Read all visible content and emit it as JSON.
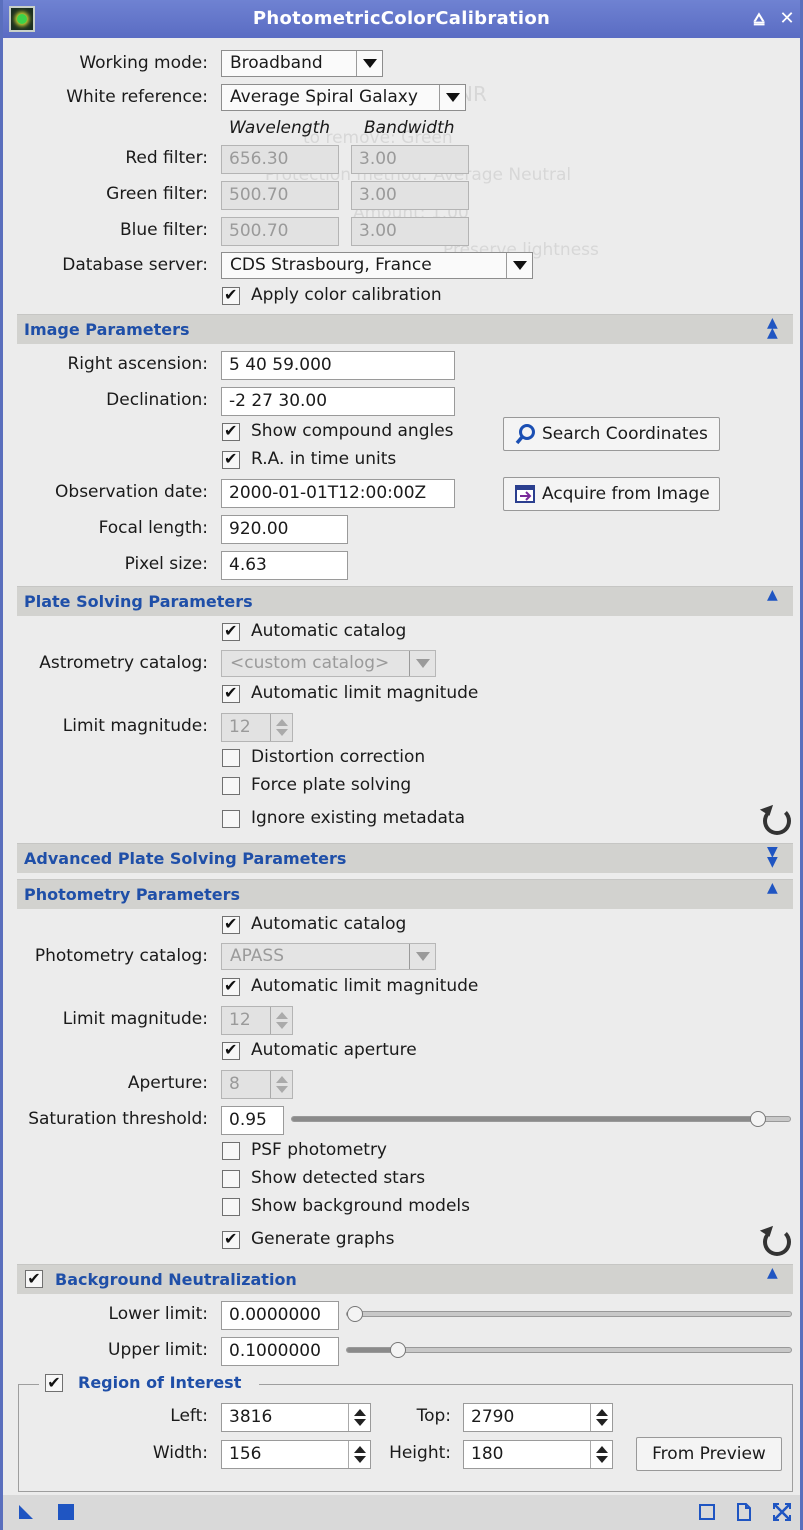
{
  "window": {
    "title": "PhotometricColorCalibration",
    "controls": [
      "pin-icon",
      "close-icon"
    ]
  },
  "general": {
    "working_mode_label": "Working mode:",
    "working_mode_value": "Broadband",
    "white_ref_label": "White reference:",
    "white_ref_value": "Average Spiral Galaxy",
    "col_wavelength": "Wavelength",
    "col_bandwidth": "Bandwidth",
    "red_label": "Red filter:",
    "red_wavelength": "656.30",
    "red_bandwidth": "3.00",
    "green_label": "Green filter:",
    "green_wavelength": "500.70",
    "green_bandwidth": "3.00",
    "blue_label": "Blue filter:",
    "blue_wavelength": "500.70",
    "blue_bandwidth": "3.00",
    "db_label": "Database server:",
    "db_value": "CDS Strasbourg, France",
    "apply_label": "Apply color calibration",
    "apply_checked": true
  },
  "image_params": {
    "title": "Image Parameters",
    "ra_label": "Right ascension:",
    "ra_value": "5 40 59.000",
    "dec_label": "Declination:",
    "dec_value": "-2 27 30.00",
    "compound_label": "Show compound angles",
    "ra_time_label": "R.A. in time units",
    "search_button": "Search Coordinates",
    "obs_label": "Observation date:",
    "obs_value": "2000-01-01T12:00:00Z",
    "acquire_button": "Acquire from Image",
    "focal_label": "Focal length:",
    "focal_value": "920.00",
    "pixel_label": "Pixel size:",
    "pixel_value": "4.63"
  },
  "plate_solving": {
    "title": "Plate Solving Parameters",
    "auto_catalog_label": "Automatic catalog",
    "astrometry_label": "Astrometry catalog:",
    "astrometry_value": "<custom catalog>",
    "auto_limit_label": "Automatic limit magnitude",
    "limit_label": "Limit magnitude:",
    "limit_value": "12",
    "distortion_label": "Distortion correction",
    "force_label": "Force plate solving",
    "ignore_label": "Ignore existing metadata"
  },
  "advanced_plate": {
    "title": "Advanced Plate Solving Parameters"
  },
  "photometry": {
    "title": "Photometry Parameters",
    "auto_catalog_label": "Automatic catalog",
    "catalog_label": "Photometry catalog:",
    "catalog_value": "APASS",
    "auto_limit_label": "Automatic limit magnitude",
    "limit_label": "Limit magnitude:",
    "limit_value": "12",
    "auto_aperture_label": "Automatic aperture",
    "aperture_label": "Aperture:",
    "aperture_value": "8",
    "saturation_label": "Saturation threshold:",
    "saturation_value": "0.95",
    "saturation_fraction": 0.95,
    "psf_label": "PSF photometry",
    "stars_label": "Show detected stars",
    "bg_models_label": "Show background models",
    "graphs_label": "Generate graphs"
  },
  "background": {
    "title": "Background Neutralization",
    "lower_label": "Lower limit:",
    "lower_value": "0.0000000",
    "lower_fraction": 0.0,
    "upper_label": "Upper limit:",
    "upper_value": "0.1000000",
    "upper_fraction": 0.1
  },
  "roi": {
    "title": "Region of Interest",
    "left_label": "Left:",
    "left_value": "3816",
    "top_label": "Top:",
    "top_value": "2790",
    "width_label": "Width:",
    "width_value": "156",
    "height_label": "Height:",
    "height_value": "180",
    "from_preview_button": "From Preview"
  },
  "colors": {
    "titlebar": "#5a6cc3",
    "section_title": "#1f4fa8",
    "section_bg": "#d2d2cf"
  }
}
